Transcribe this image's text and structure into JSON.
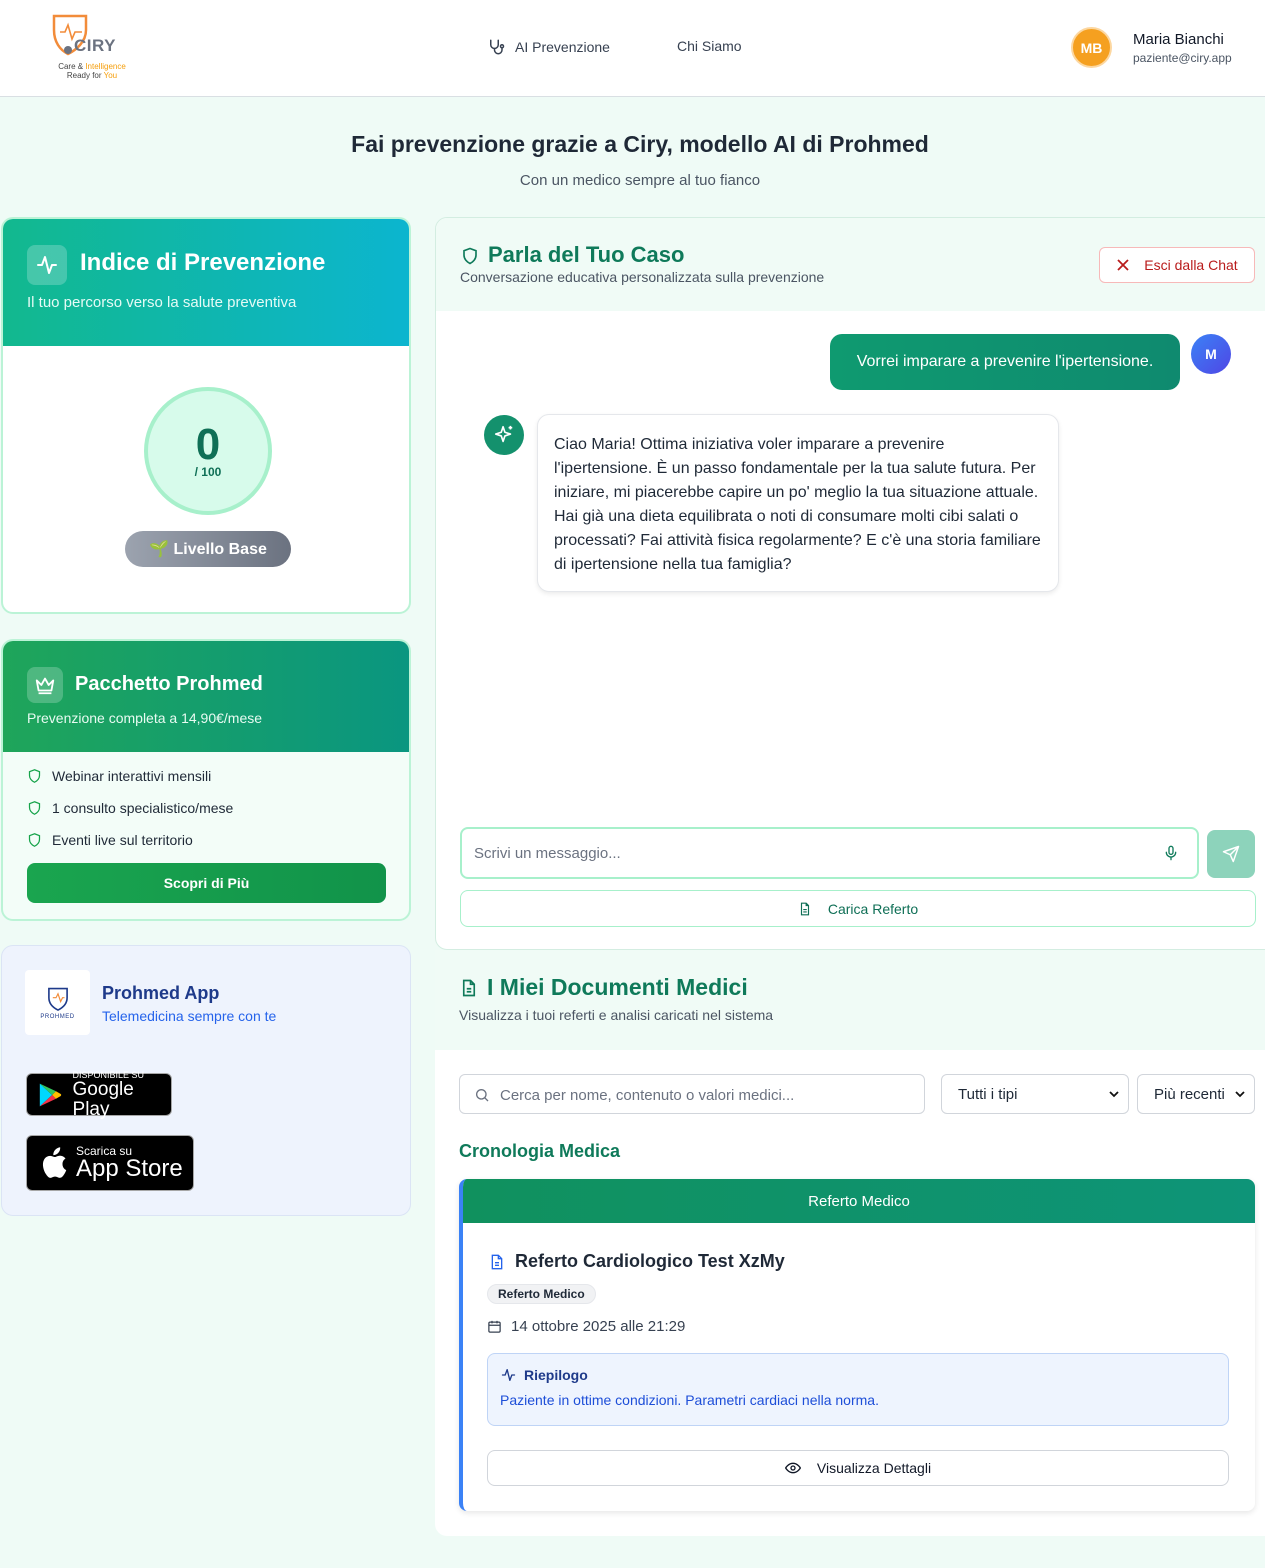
{
  "header": {
    "logo": {
      "name": "CIRY",
      "tagline_1": "Care &",
      "tagline_2": "Intelligence",
      "tagline_3": "Ready for",
      "tagline_4": "You"
    },
    "nav": [
      {
        "label": "AI Prevenzione",
        "icon": "stethoscope-icon"
      },
      {
        "label": "Chi Siamo"
      }
    ],
    "user": {
      "initials": "MB",
      "name": "Maria Bianchi",
      "email": "paziente@ciry.app",
      "avatar_color": "#f5a020"
    }
  },
  "hero": {
    "title": "Fai prevenzione grazie a Ciry, modello AI di Prohmed",
    "subtitle": "Con un medico sempre al tuo fianco"
  },
  "prevention_index": {
    "title": "Indice di Prevenzione",
    "subtitle": "Il tuo percorso verso la salute preventiva",
    "score": "0",
    "max": "/ 100",
    "level": "🌱 Livello Base"
  },
  "package": {
    "title": "Pacchetto Prohmed",
    "subtitle": "Prevenzione completa a 14,90€/mese",
    "features": [
      "Webinar interattivi mensili",
      "1 consulto specialistico/mese",
      "Eventi live sul territorio"
    ],
    "cta": "Scopri di Più"
  },
  "app_promo": {
    "logo_text": "PROHMED",
    "title": "Prohmed App",
    "subtitle": "Telemedicina sempre con te",
    "google_play": {
      "small": "DISPONIBILE SU",
      "big": "Google Play"
    },
    "app_store": {
      "small": "Scarica su",
      "big": "App Store"
    }
  },
  "chat": {
    "title": "Parla del Tuo Caso",
    "subtitle": "Conversazione educativa personalizzata sulla prevenzione",
    "exit_label": "Esci dalla Chat",
    "user_initial": "M",
    "messages": [
      {
        "role": "user",
        "text": "Vorrei imparare a prevenire l'ipertensione."
      },
      {
        "role": "assistant",
        "text": "Ciao Maria! Ottima iniziativa voler imparare a prevenire l'ipertensione. È un passo fondamentale per la tua salute futura. Per iniziare, mi piacerebbe capire un po' meglio la tua situazione attuale. Hai già una dieta equilibrata o noti di consumare molti cibi salati o processati? Fai attività fisica regolarmente? E c'è una storia familiare di ipertensione nella tua famiglia?"
      }
    ],
    "input_placeholder": "Scrivi un messaggio...",
    "upload_label": "Carica Referto"
  },
  "documents": {
    "title": "I Miei Documenti Medici",
    "subtitle": "Visualizza i tuoi referti e analisi caricati nel sistema",
    "search_placeholder": "Cerca per nome, contenuto o valori medici...",
    "type_filter": "Tutti i tipi",
    "sort": "Più recenti",
    "timeline_title": "Cronologia Medica",
    "items": [
      {
        "band": "Referto Medico",
        "title": "Referto Cardiologico Test XzMy",
        "badge": "Referto Medico",
        "date": "14 ottobre 2025 alle 21:29",
        "summary_title": "Riepilogo",
        "summary_text": "Paziente in ottime condizioni. Parametri cardiaci nella norma.",
        "details_label": "Visualizza Dettagli"
      }
    ]
  }
}
